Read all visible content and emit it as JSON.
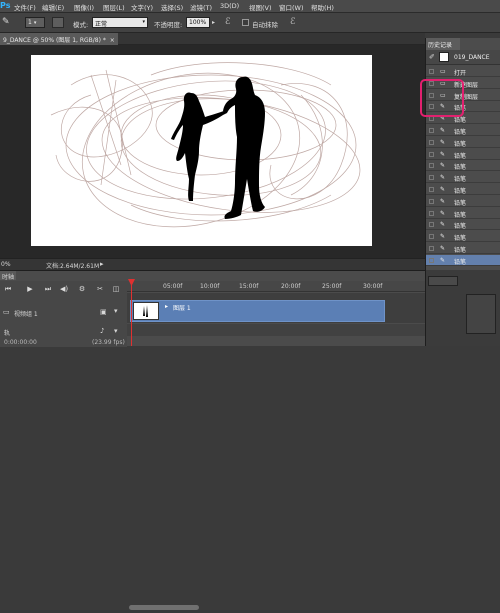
{
  "menu": {
    "logo": "Ps",
    "items": [
      "文件(F)",
      "编辑(E)",
      "图像(I)",
      "图层(L)",
      "文字(Y)",
      "选择(S)",
      "滤镜(T)",
      "3D(D)",
      "视图(V)",
      "窗口(W)",
      "帮助(H)"
    ]
  },
  "options": {
    "brush_size": "1",
    "mode_label": "模式:",
    "mode_value": "正常",
    "opacity_label": "不透明度:",
    "opacity_value": "100%",
    "auto_erase_label": "自动抹除"
  },
  "document": {
    "tab_label": "9_DANCE @ 50% (图层 1, RGB/8) *",
    "close": "×"
  },
  "status": {
    "zoom": "0%",
    "doc_info": "文档:2.64M/2.61M"
  },
  "history": {
    "tab_label": "历史记录",
    "snapshot_name": "019_DANCE",
    "rows": [
      {
        "icon": "folder-icon",
        "label": "打开"
      },
      {
        "icon": "folder-icon",
        "label": "新建图层"
      },
      {
        "icon": "folder-icon",
        "label": "复制图层"
      },
      {
        "icon": "pencil-icon",
        "label": "铅笔"
      },
      {
        "icon": "pencil-icon",
        "label": "铅笔"
      },
      {
        "icon": "pencil-icon",
        "label": "铅笔"
      },
      {
        "icon": "pencil-icon",
        "label": "铅笔"
      },
      {
        "icon": "pencil-icon",
        "label": "铅笔"
      },
      {
        "icon": "pencil-icon",
        "label": "铅笔"
      },
      {
        "icon": "pencil-icon",
        "label": "铅笔"
      },
      {
        "icon": "pencil-icon",
        "label": "铅笔"
      },
      {
        "icon": "pencil-icon",
        "label": "铅笔"
      },
      {
        "icon": "pencil-icon",
        "label": "铅笔"
      },
      {
        "icon": "pencil-icon",
        "label": "铅笔"
      },
      {
        "icon": "pencil-icon",
        "label": "铅笔"
      },
      {
        "icon": "pencil-icon",
        "label": "铅笔"
      },
      {
        "icon": "pencil-icon",
        "label": "铅笔",
        "selected": true
      }
    ]
  },
  "timeline": {
    "tab_label": "时轴",
    "ticks": [
      "05:00f",
      "10:00f",
      "15:00f",
      "20:00f",
      "25:00f",
      "30:00f"
    ],
    "video_group_label": "视频组 1",
    "clip_label": "图层 1",
    "audio_label": "轨",
    "timecode": "0:00:00:00",
    "fps": "(23.99 fps)"
  },
  "colors": {
    "accent_highlight": "#e2206f",
    "selected_row": "#6380ad",
    "clip": "#5b7fb5"
  }
}
